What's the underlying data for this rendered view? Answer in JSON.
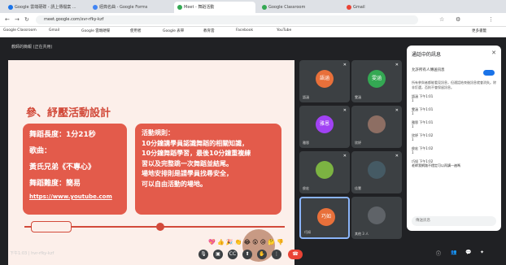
{
  "browser": {
    "tabs": [
      {
        "label": "Google 雲端硬碟 - 請上傳檔案 ...",
        "color": "#1a73e8"
      },
      {
        "label": "經典名曲 - Google Forms",
        "color": "#4285f4"
      },
      {
        "label": "Meet - 舞蹈活動",
        "color": "#34a853",
        "active": true
      },
      {
        "label": "Google Classroom",
        "color": "#34a853"
      },
      {
        "label": "Gmail",
        "color": "#ea4335"
      }
    ],
    "url": "meet.google.com/xvr-rfky-kzf",
    "bookmarks": [
      "Google Classroom",
      "Gmail",
      "Google 雲端硬碟",
      "使用者",
      "Google 表單",
      "教育雲",
      "Facebook",
      "YouTube",
      "更多書籤"
    ]
  },
  "meet": {
    "header": "教師的簡報 (正在共用)",
    "time": "下午1:03 | hvr-rfky-kzf",
    "slide": {
      "title": "參、紓壓活動設計",
      "left": [
        "舞蹈長度：1分21秒",
        "歌曲：",
        "黃氏兄弟《不專心》",
        "舞蹈難度：簡易"
      ],
      "link": "https://www.youtube.com",
      "right": [
        "活動規則：",
        "10分鐘講學員認識舞蹈的相關知識，",
        "10分鐘舞蹈學習，最後10分鐘重複練",
        "習以及完整跳一次舞蹈並結尾。",
        "場地安排則是請學員找尋安全，",
        "可以自由活動的場地。"
      ]
    },
    "tiles": [
      {
        "initials": "語涵",
        "name": "語涵",
        "color": "#e8703a"
      },
      {
        "initials": "雯涵",
        "name": "雯涵",
        "color": "#34a853"
      },
      {
        "initials": "雅恩",
        "name": "雅恩",
        "color": "#a142f4"
      },
      {
        "initials": "",
        "name": "欣妤",
        "color": "#8d6e63"
      },
      {
        "initials": "",
        "name": "俊宏",
        "color": "#7cb342"
      },
      {
        "initials": "",
        "name": "佳慧",
        "color": "#455a64"
      },
      {
        "initials": "巧如",
        "name": "巧如",
        "color": "#e8703a"
      },
      {
        "initials": "",
        "name": "其他 3 人",
        "color": "#5f6368"
      }
    ],
    "chat": {
      "title": "通話中的訊息",
      "toggle_label": "允許所有人傳送訊息",
      "note": "所有參與者都能看見訊息，但通話結束後訊息就會消失。除非釘選，否則不會保留訊息。",
      "messages": [
        {
          "who": "語涵 下午1:01",
          "text": "1"
        },
        {
          "who": "雯涵 下午1:01",
          "text": "1"
        },
        {
          "who": "雅恩 下午1:01",
          "text": "1"
        },
        {
          "who": "欣妤 下午1:02",
          "text": "1"
        },
        {
          "who": "俊宏 下午1:02",
          "text": "1"
        },
        {
          "who": "巧如 下午1:02",
          "text": "老師我網路不穩定可以再講一遍嗎"
        }
      ],
      "input_placeholder": "傳送訊息"
    }
  }
}
